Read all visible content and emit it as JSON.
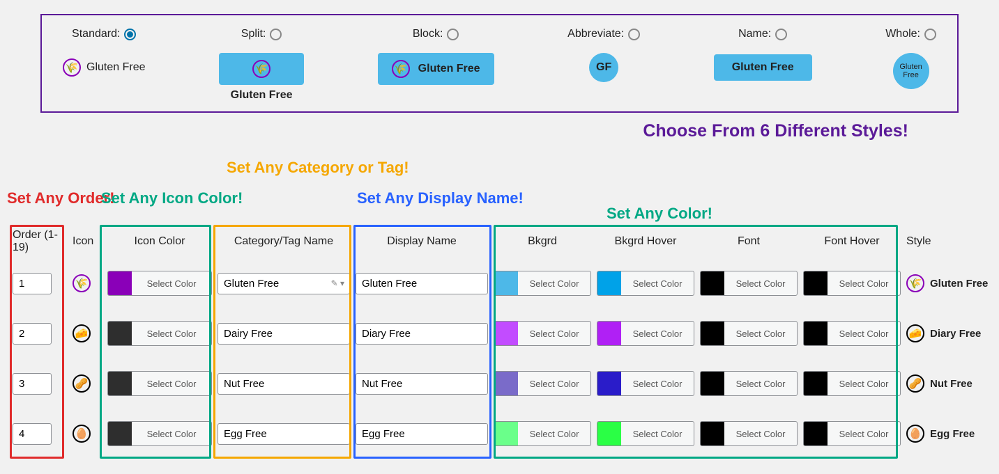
{
  "styles": {
    "standard": {
      "label": "Standard:",
      "selected": true,
      "preview_text": "Gluten Free"
    },
    "split": {
      "label": "Split:",
      "selected": false,
      "preview_text": "Gluten Free"
    },
    "block": {
      "label": "Block:",
      "selected": false,
      "preview_text": "Gluten Free"
    },
    "abbreviate": {
      "label": "Abbreviate:",
      "selected": false,
      "preview_text": "GF"
    },
    "name": {
      "label": "Name:",
      "selected": false,
      "preview_text": "Gluten Free"
    },
    "whole": {
      "label": "Whole:",
      "selected": false,
      "preview_text": "Gluten Free"
    }
  },
  "tagline": "Choose From 6 Different Styles!",
  "annotations": {
    "order": "Set Any Order!",
    "icon_color": "Set Any Icon Color!",
    "category": "Set Any Category or Tag!",
    "display_name": "Set Any Display Name!",
    "any_color": "Set Any Color!"
  },
  "headers": {
    "order": "Order (1-19)",
    "icon": "Icon",
    "icon_color": "Icon Color",
    "category": "Category/Tag Name",
    "display": "Display Name",
    "bkgrd": "Bkgrd",
    "bkgrd_hover": "Bkgrd Hover",
    "font": "Font",
    "font_hover": "Font Hover",
    "style": "Style"
  },
  "select_color_label": "Select Color",
  "rows": [
    {
      "order": "1",
      "icon": "wheat-icon",
      "icon_color": "#8a00b8",
      "category": "Gluten Free",
      "display": "Gluten Free",
      "bkgrd": "#4db8e8",
      "bkgrd_hover": "#00a2e8",
      "font": "#000000",
      "font_hover": "#000000",
      "style_text": "Gluten Free",
      "style_ring": "#8a00b8"
    },
    {
      "order": "2",
      "icon": "dairy-icon",
      "icon_color": "#2e2e2e",
      "category": "Dairy Free",
      "display": "Diary Free",
      "bkgrd": "#c24cff",
      "bkgrd_hover": "#b020f5",
      "font": "#000000",
      "font_hover": "#000000",
      "style_text": "Diary Free",
      "style_ring": "#000000"
    },
    {
      "order": "3",
      "icon": "nut-icon",
      "icon_color": "#2e2e2e",
      "category": "Nut Free",
      "display": "Nut Free",
      "bkgrd": "#7a6bc9",
      "bkgrd_hover": "#2a1cc9",
      "font": "#000000",
      "font_hover": "#000000",
      "style_text": "Nut Free",
      "style_ring": "#000000"
    },
    {
      "order": "4",
      "icon": "egg-icon",
      "icon_color": "#2e2e2e",
      "category": "Egg Free",
      "display": "Egg Free",
      "bkgrd": "#6aff8a",
      "bkgrd_hover": "#2aff45",
      "font": "#000000",
      "font_hover": "#000000",
      "style_text": "Egg Free",
      "style_ring": "#000000"
    }
  ]
}
